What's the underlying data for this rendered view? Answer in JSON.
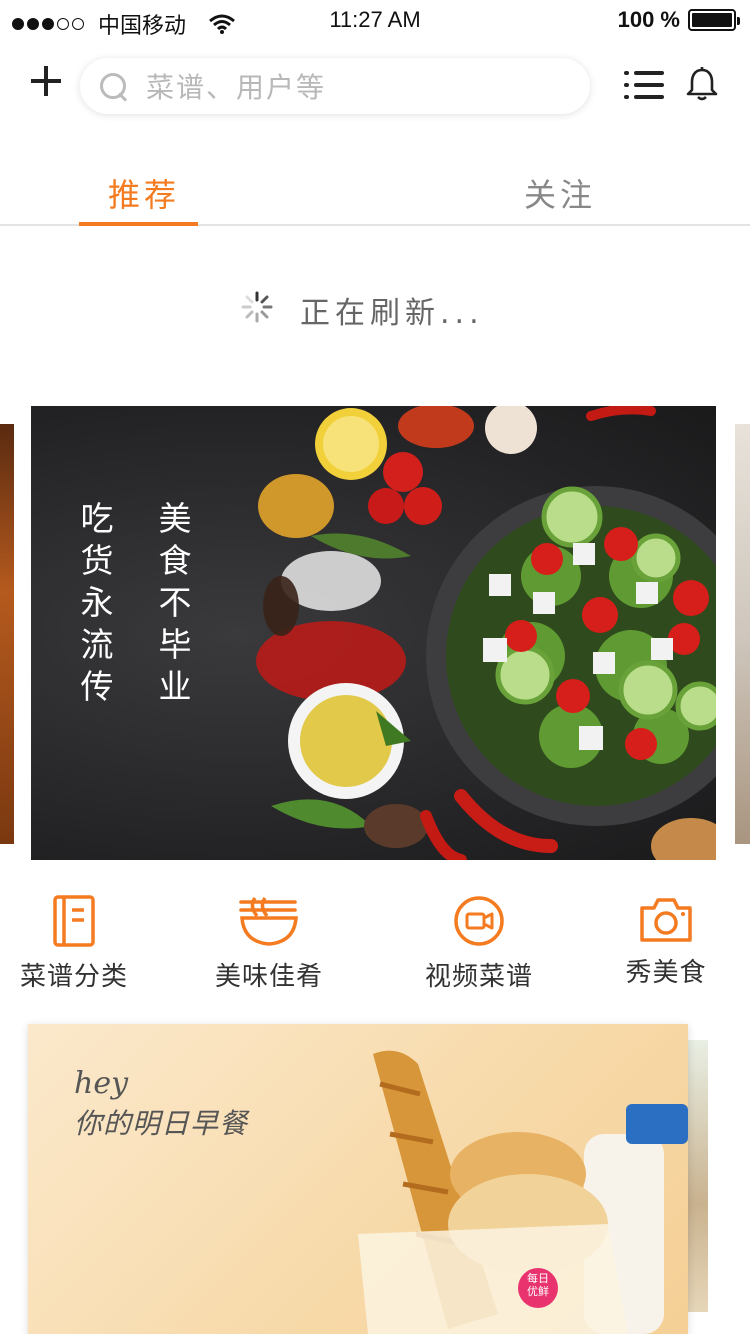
{
  "status_bar": {
    "carrier": "中国移动",
    "time": "11:27 AM",
    "battery": "100 %",
    "signal_bars": 3,
    "signal_total": 5
  },
  "header": {
    "search_placeholder": "菜谱、用户等"
  },
  "tabs": [
    {
      "label": "推荐",
      "active": true
    },
    {
      "label": "关注",
      "active": false
    }
  ],
  "refresh": {
    "text": "正在刷新..."
  },
  "banner": {
    "col1": "吃\n货\n永\n流\n传",
    "col2": "美\n食\n不\n毕\n业"
  },
  "categories": [
    {
      "label": "菜谱分类",
      "icon": "book-icon"
    },
    {
      "label": "美味佳肴",
      "icon": "bowl-icon"
    },
    {
      "label": "视频菜谱",
      "icon": "video-icon"
    },
    {
      "label": "秀美食",
      "icon": "camera-icon"
    }
  ],
  "breakfast_card": {
    "hey": "hey",
    "subtitle": "你的明日早餐",
    "badge": "每日\n优鲜"
  },
  "colors": {
    "accent": "#f47b20",
    "text_muted": "#888888"
  }
}
